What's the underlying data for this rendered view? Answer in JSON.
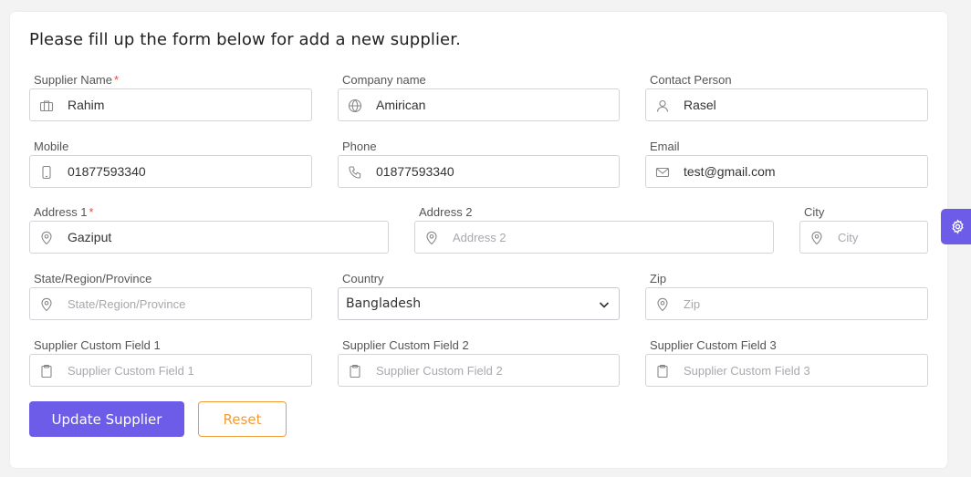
{
  "form": {
    "title": "Please fill up the form below for add a new supplier.",
    "fields": {
      "supplier_name": {
        "label": "Supplier Name",
        "required": "*",
        "value": "Rahim",
        "icon": "briefcase-icon"
      },
      "company_name": {
        "label": "Company name",
        "value": "Amirican",
        "icon": "globe-icon"
      },
      "contact_person": {
        "label": "Contact Person",
        "value": "Rasel",
        "icon": "user-icon"
      },
      "mobile": {
        "label": "Mobile",
        "value": "01877593340",
        "icon": "mobile-icon"
      },
      "phone": {
        "label": "Phone",
        "value": "01877593340",
        "icon": "phone-icon"
      },
      "email": {
        "label": "Email",
        "value": "test@gmail.com",
        "icon": "mail-icon"
      },
      "address1": {
        "label": "Address 1",
        "required": "*",
        "value": "Gaziput",
        "icon": "location-icon"
      },
      "address2": {
        "label": "Address 2",
        "value": "",
        "placeholder": "Address 2",
        "icon": "location-icon"
      },
      "city": {
        "label": "City",
        "value": "",
        "placeholder": "City",
        "icon": "location-icon"
      },
      "state": {
        "label": "State/Region/Province",
        "value": "",
        "placeholder": "State/Region/Province",
        "icon": "location-icon"
      },
      "country": {
        "label": "Country",
        "value": "Bangladesh",
        "icon": "chevron-down-icon"
      },
      "zip": {
        "label": "Zip",
        "value": "",
        "placeholder": "Zip",
        "icon": "location-icon"
      },
      "custom1": {
        "label": "Supplier Custom Field 1",
        "value": "",
        "placeholder": "Supplier Custom Field 1",
        "icon": "clipboard-icon"
      },
      "custom2": {
        "label": "Supplier Custom Field 2",
        "value": "",
        "placeholder": "Supplier Custom Field 2",
        "icon": "clipboard-icon"
      },
      "custom3": {
        "label": "Supplier Custom Field 3",
        "value": "",
        "placeholder": "Supplier Custom Field 3",
        "icon": "clipboard-icon"
      }
    },
    "buttons": {
      "update": "Update Supplier",
      "reset": "Reset"
    }
  },
  "colors": {
    "primary": "#6c5ce7",
    "reset": "#f39c3a",
    "required": "#e74c3c"
  },
  "settings_tab": {
    "icon": "gear-icon"
  }
}
